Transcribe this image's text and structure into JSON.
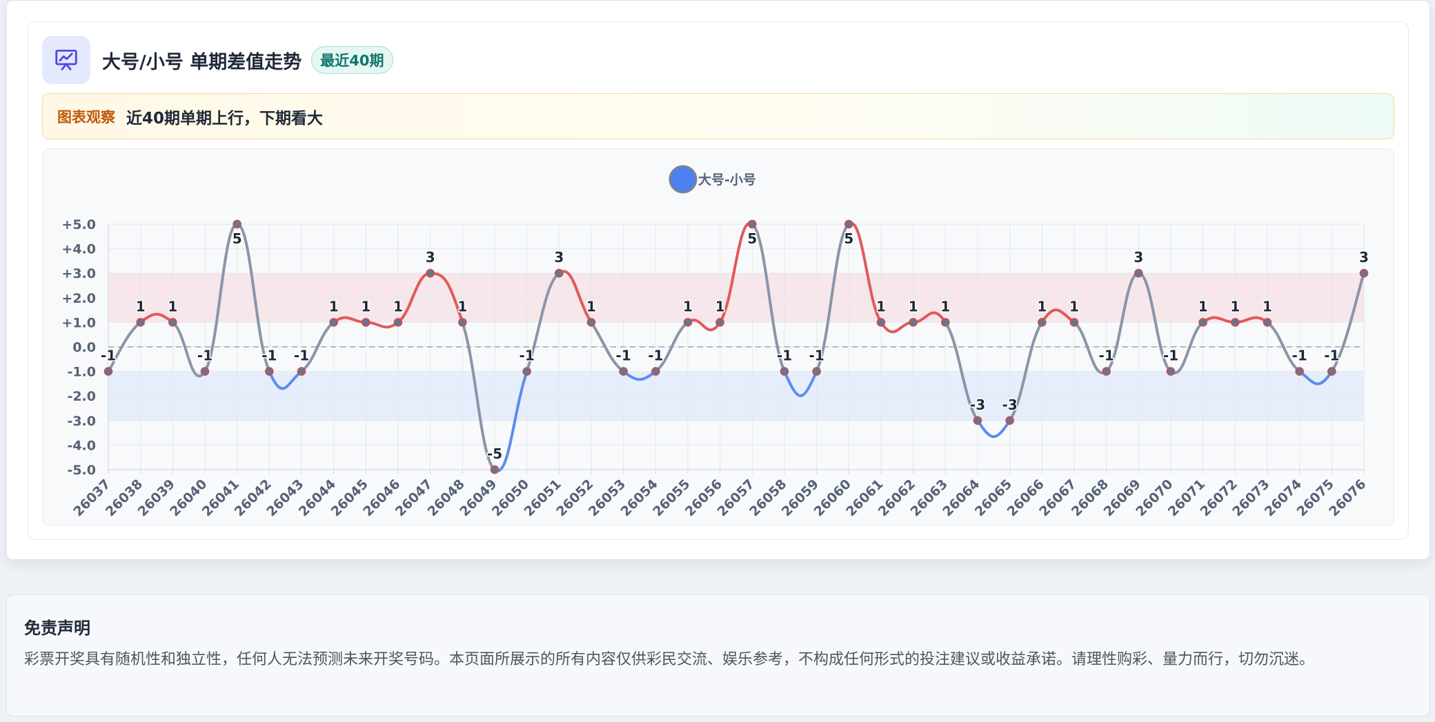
{
  "panel": {
    "title": "大号/小号 单期差值走势",
    "badge": "最近40期",
    "icon": "presentation-chart-icon",
    "observe_label": "图表观察",
    "observe_text": "近40期单期上行，下期看大"
  },
  "disclaimer": {
    "title": "免责声明",
    "text": "彩票开奖具有随机性和独立性，任何人无法预测未来开奖号码。本页面所展示的所有内容仅供彩民交流、娱乐参考，不构成任何形式的投注建议或收益承诺。请理性购彩、量力而行，切勿沉迷。"
  },
  "colors": {
    "up": "#e05a5a",
    "down": "#5b8def",
    "neutral": "#8a95a8",
    "legend": "#4a80f0",
    "band_up": "#f7e6ea",
    "band_down": "#e7eefb"
  },
  "chart_data": {
    "type": "line",
    "legend": [
      "大号-小号"
    ],
    "legend_position": "top-center",
    "ylim": [
      -5,
      5
    ],
    "yticks": [
      "+5.0",
      "+4.0",
      "+3.0",
      "+2.0",
      "+1.0",
      "0.0",
      "-1.0",
      "-2.0",
      "-3.0",
      "-4.0",
      "-5.0"
    ],
    "bands": [
      [
        1,
        3
      ],
      [
        -3,
        -1
      ]
    ],
    "grid": true,
    "categories": [
      "26037",
      "26038",
      "26039",
      "26040",
      "26041",
      "26042",
      "26043",
      "26044",
      "26045",
      "26046",
      "26047",
      "26048",
      "26049",
      "26050",
      "26051",
      "26052",
      "26053",
      "26054",
      "26055",
      "26056",
      "26057",
      "26058",
      "26059",
      "26060",
      "26061",
      "26062",
      "26063",
      "26064",
      "26065",
      "26066",
      "26067",
      "26068",
      "26069",
      "26070",
      "26071",
      "26072",
      "26073",
      "26074",
      "26075",
      "26076"
    ],
    "series": [
      {
        "name": "大号-小号",
        "values": [
          -1,
          1,
          1,
          -1,
          5,
          -1,
          -1,
          1,
          1,
          1,
          3,
          1,
          -5,
          -1,
          3,
          1,
          -1,
          -1,
          1,
          1,
          5,
          -1,
          -1,
          5,
          1,
          1,
          1,
          -3,
          -3,
          1,
          1,
          -1,
          3,
          -1,
          1,
          1,
          1,
          -1,
          -1,
          3
        ]
      }
    ]
  }
}
